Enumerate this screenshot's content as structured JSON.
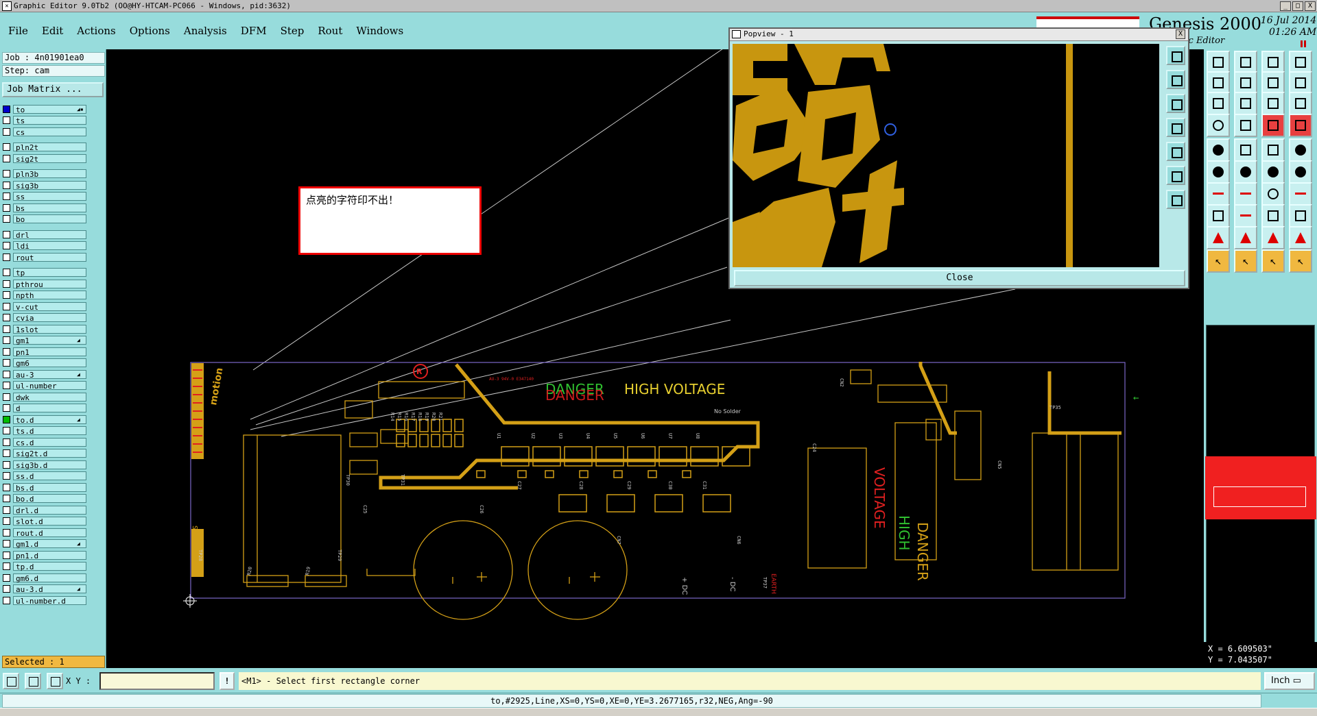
{
  "window": {
    "title": "Graphic Editor 9.0Tb2 (OO@HY-HTCAM-PC066 - Windows, pid:3632)",
    "min": "_",
    "max": "□",
    "close": "X"
  },
  "menu": [
    "File",
    "Edit",
    "Actions",
    "Options",
    "Analysis",
    "DFM",
    "Step",
    "Rout",
    "Windows"
  ],
  "logo": {
    "name": "Genesis 2000",
    "sub": "hic Editor",
    "date": "16 Jul 2014",
    "time": "01:26 AM"
  },
  "left": {
    "job": "Job : 4n01901ea0",
    "step": "Step: cam",
    "job_matrix": "Job Matrix ...",
    "selected": "Selected : 1",
    "layers": [
      {
        "name": "to",
        "color": "c-white",
        "state": "sel",
        "flag": "◢▪"
      },
      {
        "name": "ts",
        "color": "c-green"
      },
      {
        "name": "cs",
        "color": "c-orange"
      },
      {
        "name": "pln2t",
        "color": "c-board"
      },
      {
        "name": "sig2t",
        "color": "c-orange"
      },
      {
        "name": "pln3b",
        "color": "c-board"
      },
      {
        "name": "sig3b",
        "color": "c-orange"
      },
      {
        "name": "ss",
        "color": "c-orange"
      },
      {
        "name": "bs",
        "color": "c-green"
      },
      {
        "name": "bo",
        "color": "c-white"
      },
      {
        "name": "drl",
        "color": "c-gray"
      },
      {
        "name": "ldi",
        "color": "c-gray"
      },
      {
        "name": "rout",
        "color": "c-pink"
      },
      {
        "name": "tp",
        "color": "c-board"
      },
      {
        "name": "pthrou",
        "color": "c-board"
      },
      {
        "name": "npth",
        "color": "c-board"
      },
      {
        "name": "v-cut",
        "color": "c-board"
      },
      {
        "name": "cvia",
        "color": "c-board"
      },
      {
        "name": "1slot",
        "color": "c-board"
      },
      {
        "name": "gm1",
        "color": "c-board",
        "flag": "◢"
      },
      {
        "name": "pn1",
        "color": "c-board"
      },
      {
        "name": "gm6",
        "color": "c-board"
      },
      {
        "name": "au-3",
        "color": "c-board",
        "flag": "◢"
      },
      {
        "name": "ul-number",
        "color": "c-board"
      },
      {
        "name": "dwk",
        "color": "c-board"
      },
      {
        "name": "d",
        "color": "c-board"
      },
      {
        "name": "to.d",
        "color": "c-board",
        "state": "on",
        "flag": "◢"
      },
      {
        "name": "ts.d",
        "color": "c-board"
      },
      {
        "name": "cs.d",
        "color": "c-board"
      },
      {
        "name": "sig2t.d",
        "color": "c-board"
      },
      {
        "name": "sig3b.d",
        "color": "c-board"
      },
      {
        "name": "ss.d",
        "color": "c-board"
      },
      {
        "name": "bs.d",
        "color": "c-board"
      },
      {
        "name": "bo.d",
        "color": "c-board"
      },
      {
        "name": "drl.d",
        "color": "c-board"
      },
      {
        "name": "slot.d",
        "color": "c-board"
      },
      {
        "name": "rout.d",
        "color": "c-board"
      },
      {
        "name": "gm1.d",
        "color": "c-board",
        "flag": "◢"
      },
      {
        "name": "pn1.d",
        "color": "c-board"
      },
      {
        "name": "tp.d",
        "color": "c-board"
      },
      {
        "name": "gm6.d",
        "color": "c-board"
      },
      {
        "name": "au-3.d",
        "color": "c-board",
        "flag": "◢"
      },
      {
        "name": "ul-number.d",
        "color": "c-board"
      }
    ]
  },
  "note": {
    "text": "点亮的字符印不出！"
  },
  "popview": {
    "title": "Popview - 1",
    "close_label": "Close",
    "close_x": "X"
  },
  "board": {
    "danger1": "DANGER",
    "hv": "HIGH VOLTAGE",
    "no_solder": "No Solder",
    "sn": "S/N",
    "voltage": "VOLTAGE",
    "high": "HIGH",
    "danger2": "DANGER",
    "dc_plus": "+ DC",
    "dc_minus": "- DC",
    "earth": "EARTH",
    "brand": "motion",
    "ul": "AU-3 94V-0 E347140",
    "labels": [
      "R14",
      "R15",
      "R16",
      "R17",
      "R18",
      "R19",
      "R20",
      "R21",
      "U1",
      "U2",
      "U3",
      "U4",
      "U5",
      "U6",
      "U7",
      "U8",
      "C24",
      "C25",
      "C26",
      "C27",
      "C28",
      "C29",
      "C30",
      "C31",
      "CN2",
      "CN5",
      "CN6",
      "CN7",
      "TP28",
      "TP29",
      "TP30",
      "TP31",
      "TP35",
      "TP37",
      "R20",
      "R19"
    ]
  },
  "coords": {
    "x": "X = 6.609503\"",
    "y": "Y = 7.043507\""
  },
  "bottom": {
    "xy_label": "X Y :",
    "xy_value": "",
    "excl": "!",
    "prompt": "<M1> - Select first rectangle corner",
    "units": "Inch ▭",
    "status": "to,#2925,Line,XS=0,YS=0,XE=0,YE=3.2677165,r32,NEG,Ang=-90"
  },
  "colors": {
    "panel": "#97dcdc",
    "copper": "#d4a017",
    "outline": "#7b68c8",
    "red": "#e02020",
    "green": "#30c030",
    "silk": "#e8d030"
  }
}
